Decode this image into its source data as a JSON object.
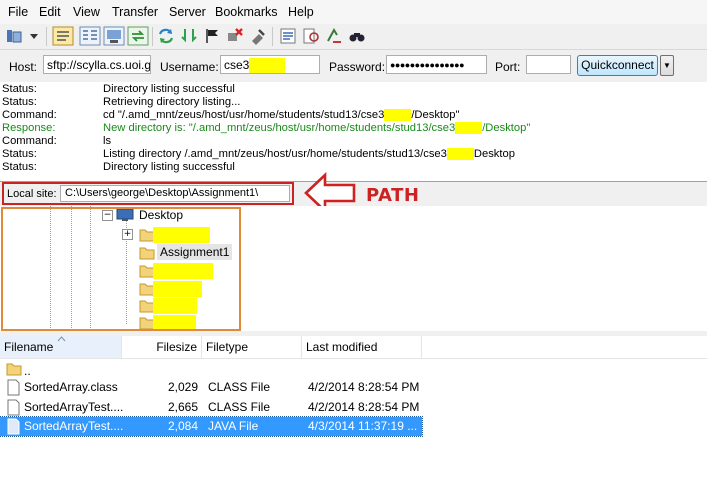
{
  "menu": [
    "File",
    "Edit",
    "View",
    "Transfer",
    "Server",
    "Bookmarks",
    "Help"
  ],
  "icons": {
    "toolbar": [
      "site-manager-icon",
      "dropdown-icon",
      "message-log-icon",
      "local-tree-icon",
      "remote-tree-icon",
      "transfer-queue-icon",
      "refresh-icon",
      "process-queue-icon",
      "cancel-icon",
      "disconnect-icon",
      "reconnect-icon",
      "directory-listing-filters-icon",
      "compare-icon",
      "sync-browsing-icon",
      "search-icon"
    ]
  },
  "quickconnect": {
    "host_label": "Host:",
    "host_value": "sftp://scylla.cs.uoi.gr",
    "username_label": "Username:",
    "username_value": "cse3",
    "password_label": "Password:",
    "password_value": "●●●●●●●●●●●●●●●",
    "port_label": "Port:",
    "port_value": "",
    "button": "Quickconnect",
    "dropdown": "▼"
  },
  "log": [
    {
      "type": "Status:",
      "msg": "Directory listing successful",
      "kind": "normal"
    },
    {
      "type": "Status:",
      "msg": "Retrieving directory listing...",
      "kind": "normal"
    },
    {
      "type": "Command:",
      "msg_a": "cd \"/.amd_mnt/zeus/host/usr/home/students/stud13/cse3",
      "msg_b": "/Desktop\"",
      "kind": "split"
    },
    {
      "type": "Response:",
      "msg_a": "New directory is: \"/.amd_mnt/zeus/host/usr/home/students/stud13/cse3",
      "msg_b": "/Desktop\"",
      "kind": "split-green"
    },
    {
      "type": "Command:",
      "msg": "ls",
      "kind": "normal"
    },
    {
      "type": "Status:",
      "msg_a": "Listing directory /.amd_mnt/zeus/host/usr/home/students/stud13/cse3",
      "msg_b": "Desktop",
      "kind": "split"
    },
    {
      "type": "Status:",
      "msg": "Directory listing successful",
      "kind": "normal"
    }
  ],
  "local_site": {
    "label": "Local site:",
    "path": "C:\\Users\\george\\Desktop\\Assignment1\\"
  },
  "annotation": {
    "text": "PATH",
    "color": "#cc2222"
  },
  "tree": {
    "root": "Desktop",
    "expand": "+",
    "collapse": "−",
    "folders": [
      "",
      "Assignment1",
      "",
      "",
      "",
      ""
    ]
  },
  "filelist": {
    "headers": [
      "Filename",
      "Filesize",
      "Filetype",
      "Last modified"
    ],
    "parent": "..",
    "rows": [
      {
        "name": "SortedArray.class",
        "size": "2,029",
        "type": "CLASS File",
        "modified": "4/2/2014 8:28:54 PM",
        "selected": false
      },
      {
        "name": "SortedArrayTest....",
        "size": "2,665",
        "type": "CLASS File",
        "modified": "4/2/2014 8:28:54 PM",
        "selected": false
      },
      {
        "name": "SortedArrayTest....",
        "size": "2,084",
        "type": "JAVA File",
        "modified": "4/3/2014 11:37:19 ...",
        "selected": true
      }
    ]
  },
  "colors": {
    "selection": "#3399ff",
    "redact": "#ffff00",
    "frame_red": "#cc2222",
    "frame_orange": "#e08a3c"
  }
}
